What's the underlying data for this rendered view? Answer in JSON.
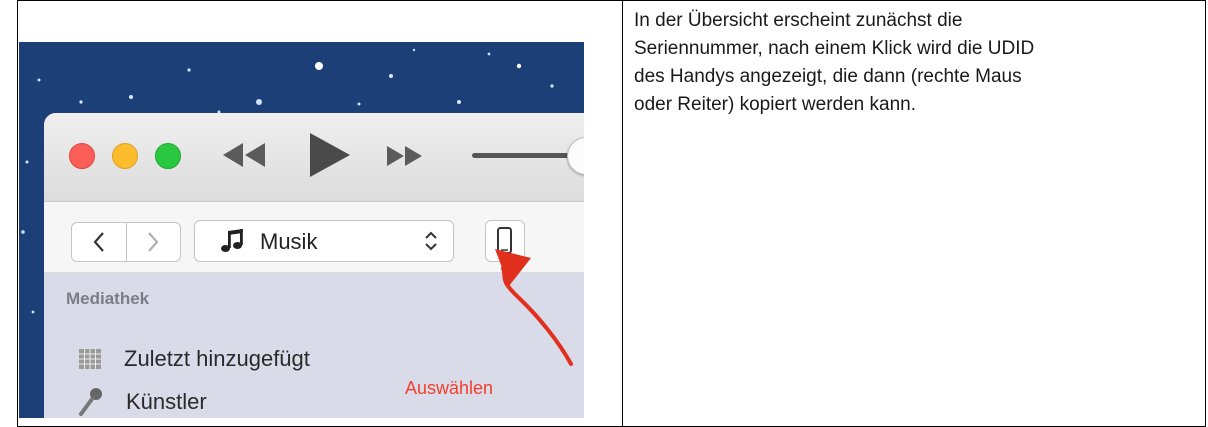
{
  "note_lines": [
    "In der Übersicht erscheint zunächst die",
    "Seriennummer, nach einem Klick wird die UDID",
    "des Handys angezeigt, die dann (rechte Maus",
    "oder Reiter) kopiert werden kann."
  ],
  "itunes": {
    "source_label": "Musik",
    "sidebar": {
      "heading": "Mediathek",
      "items": [
        {
          "label": "Zuletzt hinzugefügt",
          "icon": "grid-icon"
        },
        {
          "label": "Künstler",
          "icon": "microphone-icon"
        }
      ]
    },
    "callout": "Auswählen"
  },
  "colors": {
    "desktop": "#1d3f78",
    "traffic_red": "#fc5f57",
    "traffic_yellow": "#fdbc2e",
    "traffic_green": "#29c840",
    "annotation_red": "#f2402a"
  }
}
